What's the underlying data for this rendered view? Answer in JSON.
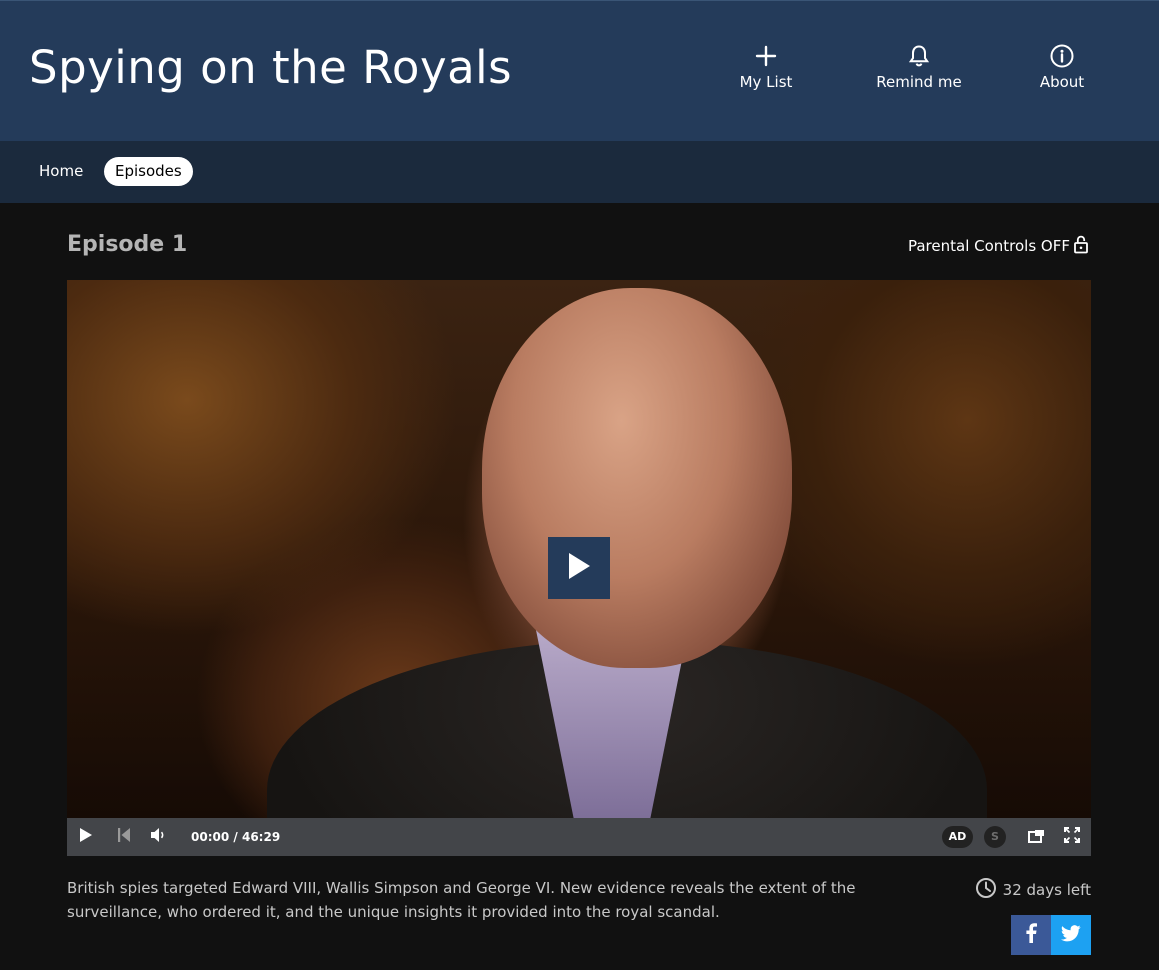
{
  "header": {
    "title": "Spying on the Royals",
    "actions": [
      {
        "label": "My List",
        "icon": "plus-icon"
      },
      {
        "label": "Remind me",
        "icon": "bell-icon"
      },
      {
        "label": "About",
        "icon": "info-icon"
      }
    ]
  },
  "nav": {
    "items": [
      {
        "label": "Home",
        "active": false
      },
      {
        "label": "Episodes",
        "active": true
      }
    ]
  },
  "episode": {
    "title": "Episode 1",
    "parental_controls": "Parental Controls OFF",
    "parental_icon": "lock-open-icon",
    "description": "British spies targeted Edward VIII, Wallis Simpson and George VI. New evidence reveals the extent of the surveillance, who ordered it, and the unique insights it provided into the royal scandal.",
    "availability": "32 days left",
    "availability_icon": "clock-icon"
  },
  "player": {
    "current_time": "00:00",
    "separator": "/",
    "duration": "46:29",
    "audio_description_label": "AD",
    "subtitles_label": "S",
    "icons": [
      "play-icon",
      "skip-back-icon",
      "volume-icon",
      "popout-icon",
      "fullscreen-icon"
    ]
  },
  "share": {
    "facebook_label": "f",
    "icons": [
      "facebook-icon",
      "twitter-icon"
    ]
  },
  "colors": {
    "header_bg": "#243b5a",
    "subnav_bg": "#1b2a3d",
    "page_bg": "#111111",
    "controls_bg": "#434549",
    "facebook": "#3b5998",
    "twitter": "#1da1f2"
  }
}
